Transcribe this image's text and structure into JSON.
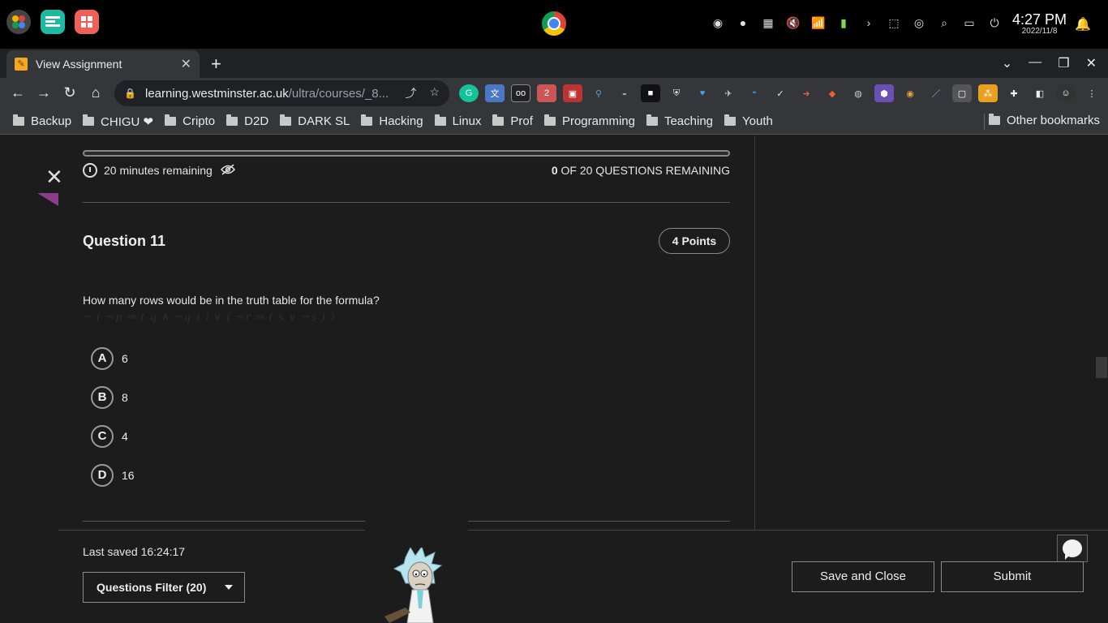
{
  "os": {
    "time": "4:27 PM",
    "date": "2022/11/8"
  },
  "browser": {
    "tab_title": "View Assignment",
    "url_host": "learning.westminster.ac.uk",
    "url_path": "/ultra/courses/_8...",
    "bookmarks": [
      "Backup",
      "CHIGU ❤",
      "Cripto",
      "D2D",
      "DARK SL",
      "Hacking",
      "Linux",
      "Prof",
      "Programming",
      "Teaching",
      "Youth"
    ],
    "other_bookmarks": "Other bookmarks"
  },
  "assessment": {
    "timer_text": "20 minutes remaining",
    "remaining_count": "0",
    "remaining_text": "OF 20 QUESTIONS REMAINING",
    "question_title": "Question 11",
    "points": "4 Points",
    "question_text": "How many rows would be in the truth table for the formula?",
    "formula": "¬ ( ¬p ⇒ ( q ∧ ¬q ) ) ∨ ( ¬r ⇒ ( s ∨ ¬s ) )",
    "options": [
      {
        "letter": "A",
        "value": "6"
      },
      {
        "letter": "B",
        "value": "8"
      },
      {
        "letter": "C",
        "value": "4"
      },
      {
        "letter": "D",
        "value": "16"
      }
    ]
  },
  "footer": {
    "last_saved": "Last saved 16:24:17",
    "filter_label": "Questions Filter (20)",
    "save_close_label": "Save and Close",
    "submit_label": "Submit"
  }
}
